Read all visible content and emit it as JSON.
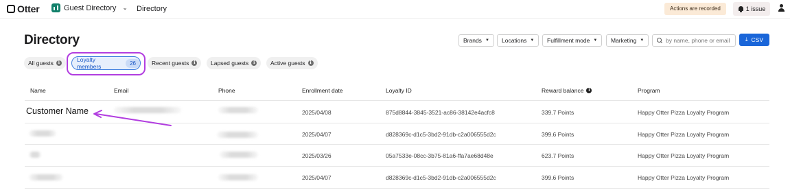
{
  "topbar": {
    "brand": "Otter",
    "app_name": "Guest Directory",
    "breadcrumb": "Directory",
    "recording_badge": "Actions are recorded",
    "issues_label": "1 issue"
  },
  "page": {
    "title": "Directory"
  },
  "filters": {
    "brands": "Brands",
    "locations": "Locations",
    "fulfillment": "Fulfillment mode",
    "marketing": "Marketing",
    "search_placeholder": "by name, phone or email",
    "csv_label": "CSV"
  },
  "segments": {
    "all": "All guests",
    "loyalty": "Loyalty members",
    "loyalty_count": "26",
    "recent": "Recent guests",
    "lapsed": "Lapsed guests",
    "active": "Active guests"
  },
  "table": {
    "headers": {
      "name": "Name",
      "email": "Email",
      "phone": "Phone",
      "enrollment": "Enrollment date",
      "loyalty_id": "Loyalty ID",
      "reward": "Reward balance",
      "program": "Program"
    },
    "rows": [
      {
        "name": "Customer Name",
        "enrollment": "2025/04/08",
        "loyalty_id": "875d8844-3845-3521-ac86-38142e4acfc8",
        "reward": "339.7 Points",
        "program": "Happy Otter Pizza Loyalty Program"
      },
      {
        "name": "",
        "enrollment": "2025/04/07",
        "loyalty_id": "d828369c-d1c5-3bd2-91db-c2a006555d2c",
        "reward": "399.6 Points",
        "program": "Happy Otter Pizza Loyalty Program"
      },
      {
        "name": "",
        "enrollment": "2025/03/26",
        "loyalty_id": "05a7533e-08cc-3b75-81a6-ffa7ae68d48e",
        "reward": "623.7 Points",
        "program": "Happy Otter Pizza Loyalty Program"
      },
      {
        "name": "",
        "enrollment": "2025/04/07",
        "loyalty_id": "d828369c-d1c5-3bd2-91db-c2a006555d2c",
        "reward": "399.6 Points",
        "program": "Happy Otter Pizza Loyalty Program"
      }
    ]
  },
  "colors": {
    "accent_blue": "#1a66d9",
    "annotation_purple": "#b23ee0",
    "brand_green": "#11806a"
  }
}
